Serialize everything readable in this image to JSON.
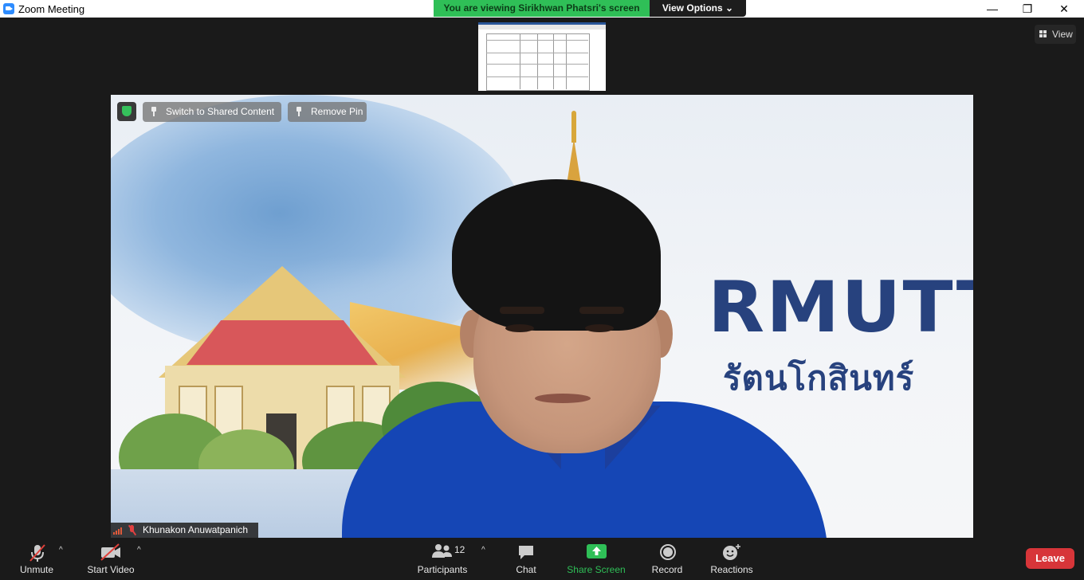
{
  "window": {
    "title": "Zoom Meeting",
    "controls": {
      "minimize": "—",
      "restore": "❐",
      "close": "✕"
    }
  },
  "banner": {
    "viewing_text": "You are viewing Sirikhwan Phatsri's screen",
    "view_options_label": "View Options",
    "view_options_caret": "⌄"
  },
  "view_button": {
    "label": "View"
  },
  "video_overlay": {
    "switch_label": "Switch to Shared Content",
    "remove_pin_label": "Remove Pin"
  },
  "video_background": {
    "logo_text": "RMUTT",
    "logo_subtext": "รัตนโกสินทร์"
  },
  "participant": {
    "name": "Khunakon Anuwatpanich",
    "muted": true
  },
  "toolbar": {
    "unmute_label": "Unmute",
    "start_video_label": "Start Video",
    "participants_label": "Participants",
    "participants_count": "12",
    "chat_label": "Chat",
    "share_screen_label": "Share Screen",
    "record_label": "Record",
    "reactions_label": "Reactions",
    "leave_label": "Leave",
    "caret": "^"
  },
  "colors": {
    "banner_green": "#2fbf57",
    "share_green": "#2fbf57",
    "leave_red": "#d73539",
    "toolbar_bg": "#1a1a1a"
  }
}
